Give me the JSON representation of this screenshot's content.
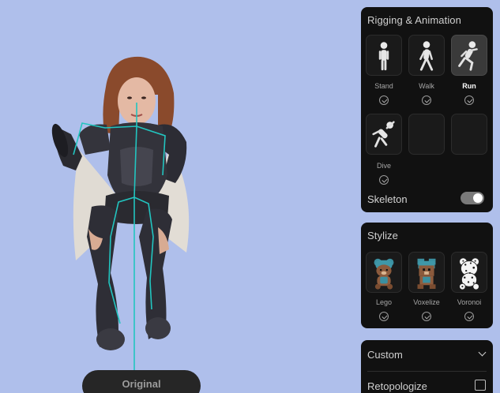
{
  "viewport": {
    "view_mode_label": "Original"
  },
  "rigging": {
    "title": "Rigging & Animation",
    "items": [
      {
        "label": "Stand",
        "icon": "stand-figure-icon",
        "selected": false
      },
      {
        "label": "Walk",
        "icon": "walk-figure-icon",
        "selected": false
      },
      {
        "label": "Run",
        "icon": "run-figure-icon",
        "selected": true
      },
      {
        "label": "Dive",
        "icon": "dive-figure-icon",
        "selected": false
      }
    ],
    "skeleton_label": "Skeleton",
    "skeleton_enabled": true
  },
  "stylize": {
    "title": "Stylize",
    "items": [
      {
        "label": "Lego",
        "icon": "lego-bear-icon"
      },
      {
        "label": "Voxelize",
        "icon": "voxel-bear-icon"
      },
      {
        "label": "Voronoi",
        "icon": "voronoi-bear-icon"
      }
    ]
  },
  "custom": {
    "title": "Custom",
    "retopologize_label": "Retopologize",
    "retopologize_checked": false
  },
  "colors": {
    "background": "#afbfeb",
    "panel": "#111111",
    "skeleton_line": "#22c5c0"
  }
}
